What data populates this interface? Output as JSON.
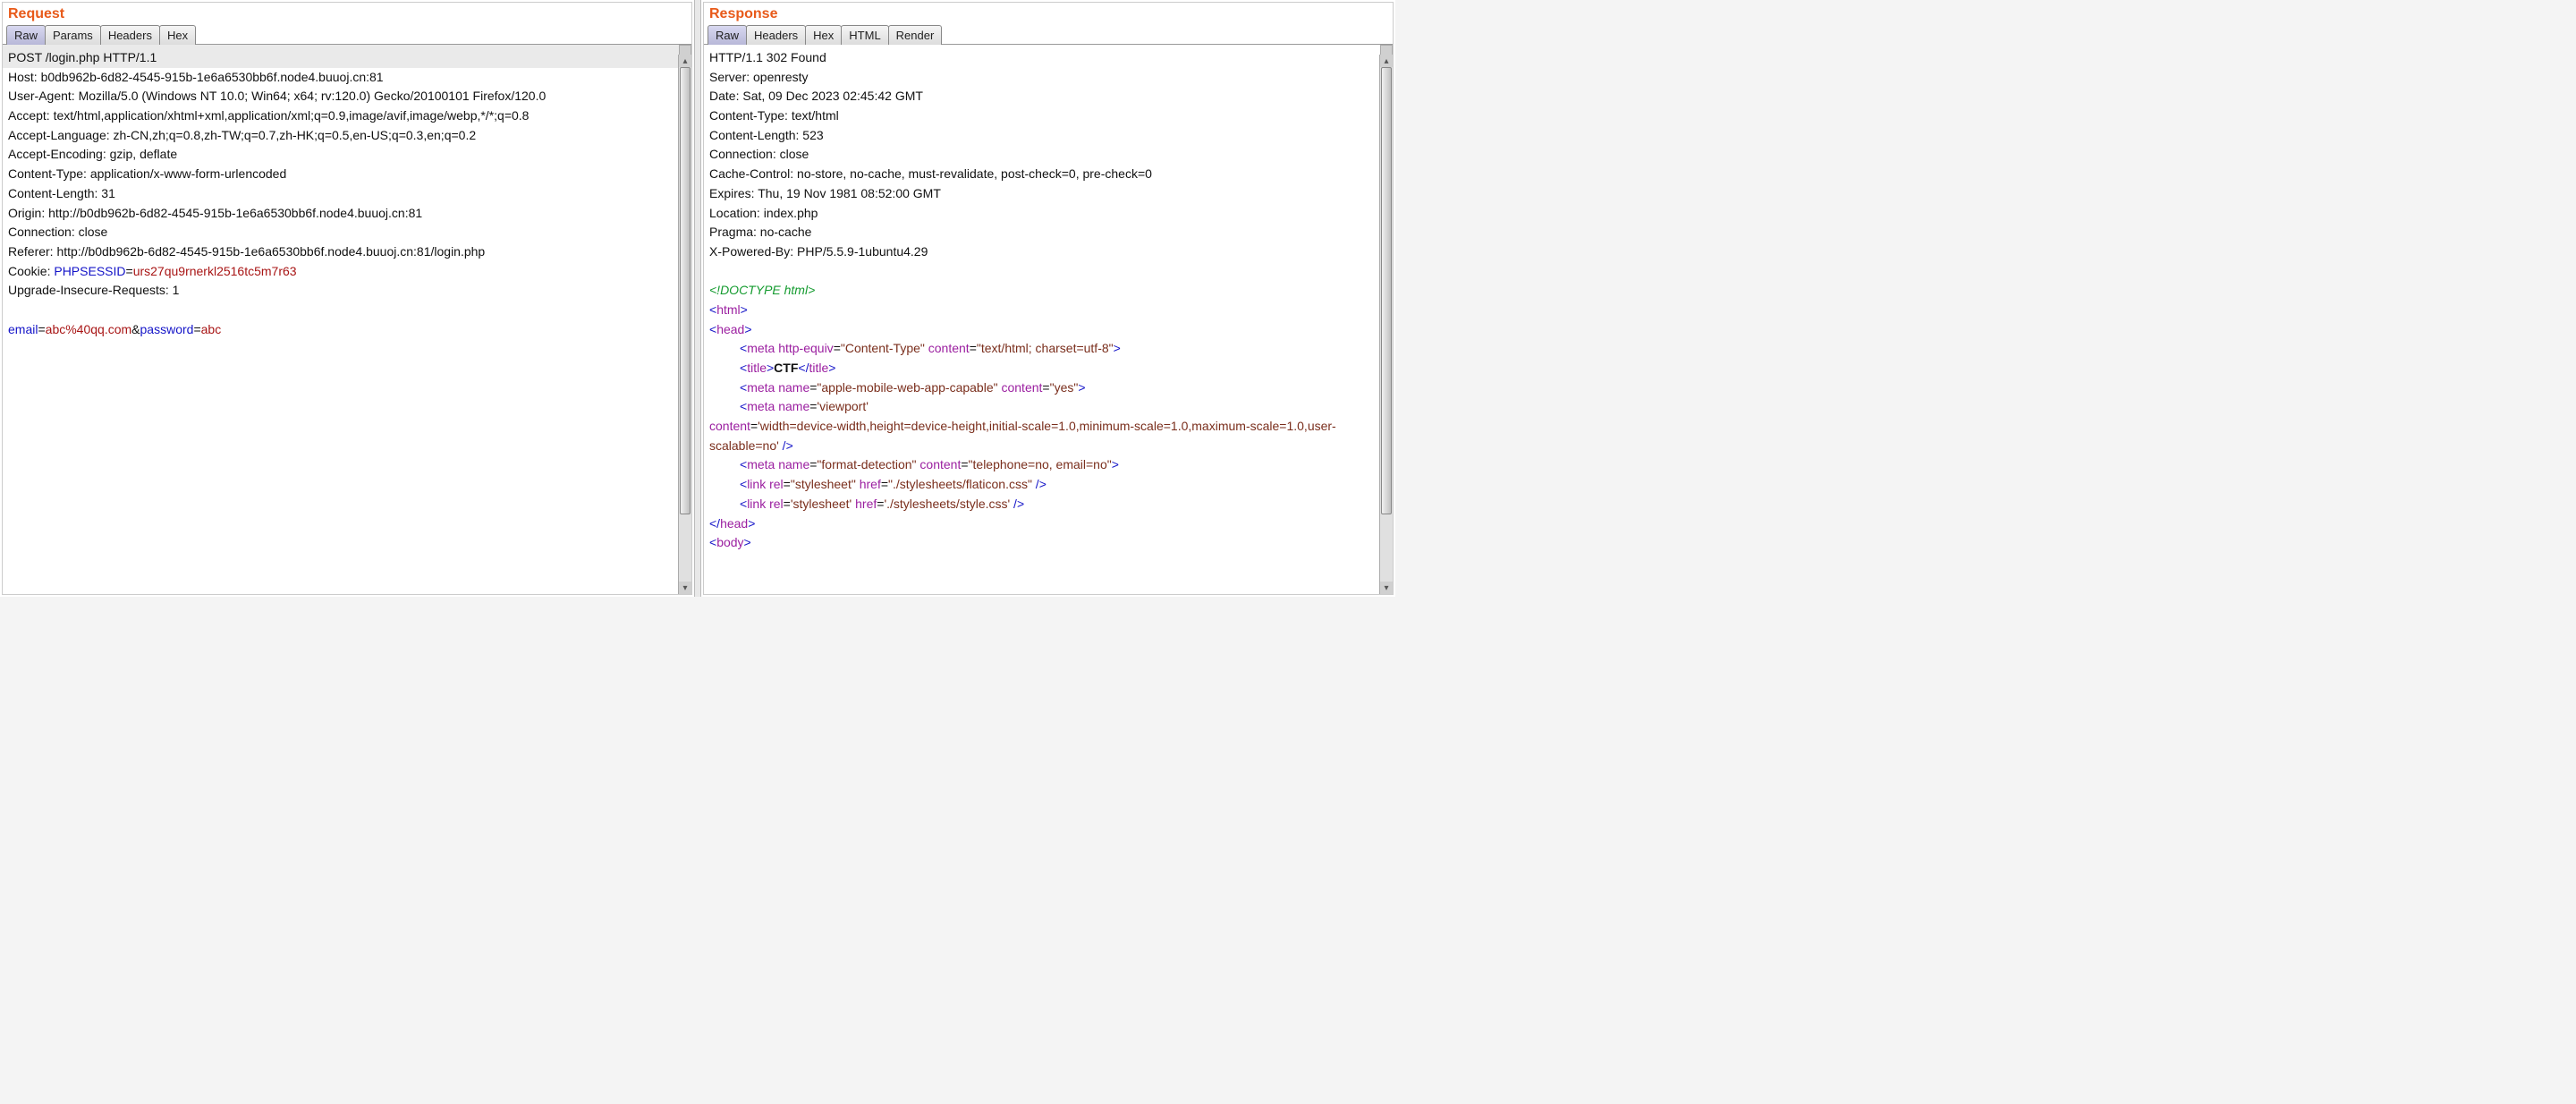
{
  "request": {
    "title": "Request",
    "tabs": [
      "Raw",
      "Params",
      "Headers",
      "Hex"
    ],
    "activeTab": 0,
    "firstLine": "POST /login.php HTTP/1.1",
    "headers": [
      "Host: b0db962b-6d82-4545-915b-1e6a6530bb6f.node4.buuoj.cn:81",
      "User-Agent: Mozilla/5.0 (Windows NT 10.0; Win64; x64; rv:120.0) Gecko/20100101 Firefox/120.0",
      "Accept: text/html,application/xhtml+xml,application/xml;q=0.9,image/avif,image/webp,*/*;q=0.8",
      "Accept-Language: zh-CN,zh;q=0.8,zh-TW;q=0.7,zh-HK;q=0.5,en-US;q=0.3,en;q=0.2",
      "Accept-Encoding: gzip, deflate",
      "Content-Type: application/x-www-form-urlencoded",
      "Content-Length: 31",
      "Origin: http://b0db962b-6d82-4545-915b-1e6a6530bb6f.node4.buuoj.cn:81",
      "Connection: close",
      "Referer: http://b0db962b-6d82-4545-915b-1e6a6530bb6f.node4.buuoj.cn:81/login.php"
    ],
    "cookie": {
      "key": "PHPSESSID",
      "value": "urs27qu9rnerkl2516tc5m7r63"
    },
    "afterCookie": "Upgrade-Insecure-Requests: 1",
    "body": {
      "p1": "email",
      "v1": "abc%40qq.com",
      "sep": "&",
      "p2": "password",
      "v2": "abc"
    }
  },
  "response": {
    "title": "Response",
    "tabs": [
      "Raw",
      "Headers",
      "Hex",
      "HTML",
      "Render"
    ],
    "activeTab": 0,
    "firstLine": "HTTP/1.1 302 Found",
    "headers": [
      "Server: openresty",
      "Date: Sat, 09 Dec 2023 02:45:42 GMT",
      "Content-Type: text/html",
      "Content-Length: 523",
      "Connection: close",
      "Cache-Control: no-store, no-cache, must-revalidate, post-check=0, pre-check=0",
      "Expires: Thu, 19 Nov 1981 08:52:00 GMT",
      "Location: index.php",
      "Pragma: no-cache",
      "X-Powered-By: PHP/5.5.9-1ubuntu4.29"
    ],
    "html": {
      "doctype": "<!DOCTYPE html>",
      "htmlOpen": {
        "lt": "<",
        "tag": "html",
        "gt": ">"
      },
      "headOpen": {
        "lt": "<",
        "tag": "head",
        "gt": ">"
      },
      "meta1": {
        "lt": "<",
        "tag": "meta",
        "a1": "http-equiv",
        "v1": "\"Content-Type\"",
        "a2": "content",
        "v2": "\"text/html; charset=utf-8\"",
        "gt": ">"
      },
      "title": {
        "lt": "<",
        "tag": "title",
        "gt": ">",
        "text": "CTF",
        "lct": "</",
        "ct": "title",
        "cgt": ">"
      },
      "meta2": {
        "lt": "<",
        "tag": "meta",
        "a1": "name",
        "v1": "\"apple-mobile-web-app-capable\"",
        "a2": "content",
        "v2": "\"yes\"",
        "gt": ">"
      },
      "meta3a": {
        "lt": "<",
        "tag": "meta",
        "a1": "name",
        "v1": "'viewport'"
      },
      "meta3b": {
        "a2": "content",
        "v2": "'width=device-width,height=device-height,initial-scale=1.0,minimum-scale=1.0,maximum-scale=1.0,user-scalable=no'",
        "gt": " />"
      },
      "meta4": {
        "lt": "<",
        "tag": "meta",
        "a1": "name",
        "v1": "\"format-detection\"",
        "a2": "content",
        "v2": "\"telephone=no, email=no\"",
        "gt": ">"
      },
      "link1": {
        "lt": "<",
        "tag": "link",
        "a1": "rel",
        "v1": "\"stylesheet\"",
        "a2": "href",
        "v2": "\"./stylesheets/flaticon.css\"",
        "gt": " />"
      },
      "link2": {
        "lt": "<",
        "tag": "link",
        "a1": "rel",
        "v1": "'stylesheet'",
        "a2": "href",
        "v2": "'./stylesheets/style.css'",
        "gt": " />"
      },
      "headClose": {
        "lt": "</",
        "tag": "head",
        "gt": ">"
      },
      "bodyOpen": {
        "lt": "<",
        "tag": "body",
        "gt": ">"
      }
    }
  }
}
